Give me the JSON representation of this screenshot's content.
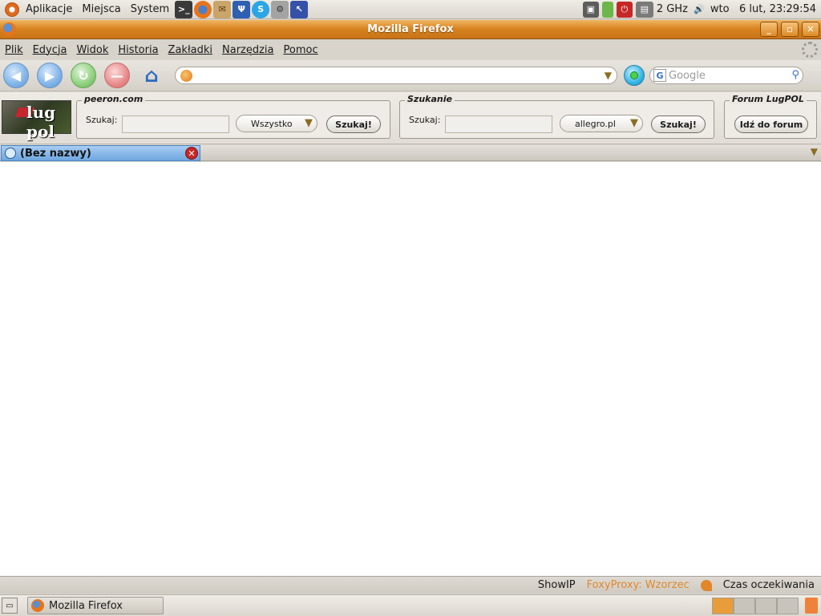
{
  "top_panel": {
    "menus": [
      "Aplikacje",
      "Miejsca",
      "System"
    ],
    "launchers": [
      "terminal-icon",
      "firefox-icon",
      "mail-icon",
      "psi-icon",
      "skype-icon",
      "settings-icon",
      "screenshot-icon"
    ],
    "cpu_freq": "2 GHz",
    "clock": "wto   6 lut, 23:29:54"
  },
  "window": {
    "title": "Mozilla Firefox"
  },
  "menubar": {
    "items": [
      "Plik",
      "Edycja",
      "Widok",
      "Historia",
      "Zakładki",
      "Narzędzia",
      "Pomoc"
    ]
  },
  "navbar": {
    "url_value": "",
    "search_placeholder": "Google",
    "search_engine_letter": "G"
  },
  "toolbar": {
    "logo_text": "lug pol",
    "peeron": {
      "legend": "peeron.com",
      "label": "Szukaj:",
      "select": "Wszystko",
      "button": "Szukaj!"
    },
    "szukanie": {
      "legend": "Szukanie",
      "label": "Szukaj:",
      "select": "allegro.pl",
      "button": "Szukaj!"
    },
    "forum": {
      "legend": "Forum LugPOL",
      "button": "Idź do forum"
    }
  },
  "tabs": [
    {
      "label": "(Bez nazwy)",
      "active": true
    }
  ],
  "statusbar": {
    "showip": "ShowIP",
    "foxyproxy": "FoxyProxy: Wzorzec",
    "status": "Czas oczekiwania"
  },
  "bottom_panel": {
    "task": "Mozilla Firefox",
    "workspaces": 4
  }
}
